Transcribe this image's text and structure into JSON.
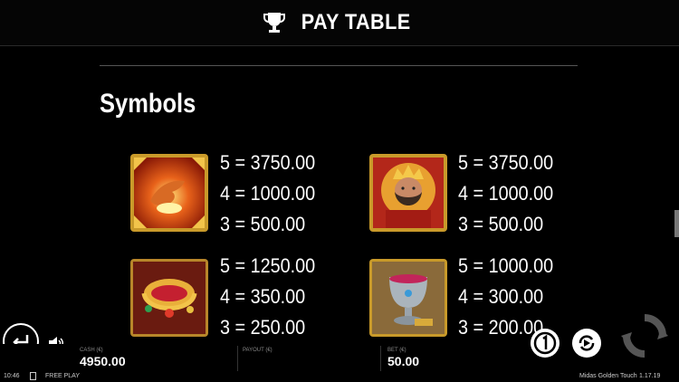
{
  "header": {
    "title": "PAY TABLE",
    "icon": "trophy-icon"
  },
  "section": {
    "title": "Symbols"
  },
  "symbols": [
    {
      "name": "hand-symbol",
      "pays": [
        "5 = 3750.00",
        "4 = 1000.00",
        "3 = 500.00"
      ]
    },
    {
      "name": "king-symbol",
      "pays": [
        "5 = 3750.00",
        "4 = 1000.00",
        "3 = 500.00"
      ]
    },
    {
      "name": "crown-symbol",
      "pays": [
        "5 = 1250.00",
        "4 = 350.00",
        "3 = 250.00"
      ]
    },
    {
      "name": "goblet-symbol",
      "pays": [
        "5 = 1000.00",
        "4 = 300.00",
        "3 = 200.00"
      ]
    }
  ],
  "bottom": {
    "cash_label": "CASH (€)",
    "cash_value": "4950.00",
    "payout_label": "PAYOUT (€)",
    "bet_label": "BET (€)",
    "bet_value": "50.00",
    "clock": "10:46",
    "mode": "FREE PLAY",
    "game_name": "Midas Golden Touch",
    "version": "1.17.19"
  },
  "colors": {
    "gold": "#d9a52a",
    "red": "#c0281b",
    "background": "#000000"
  }
}
